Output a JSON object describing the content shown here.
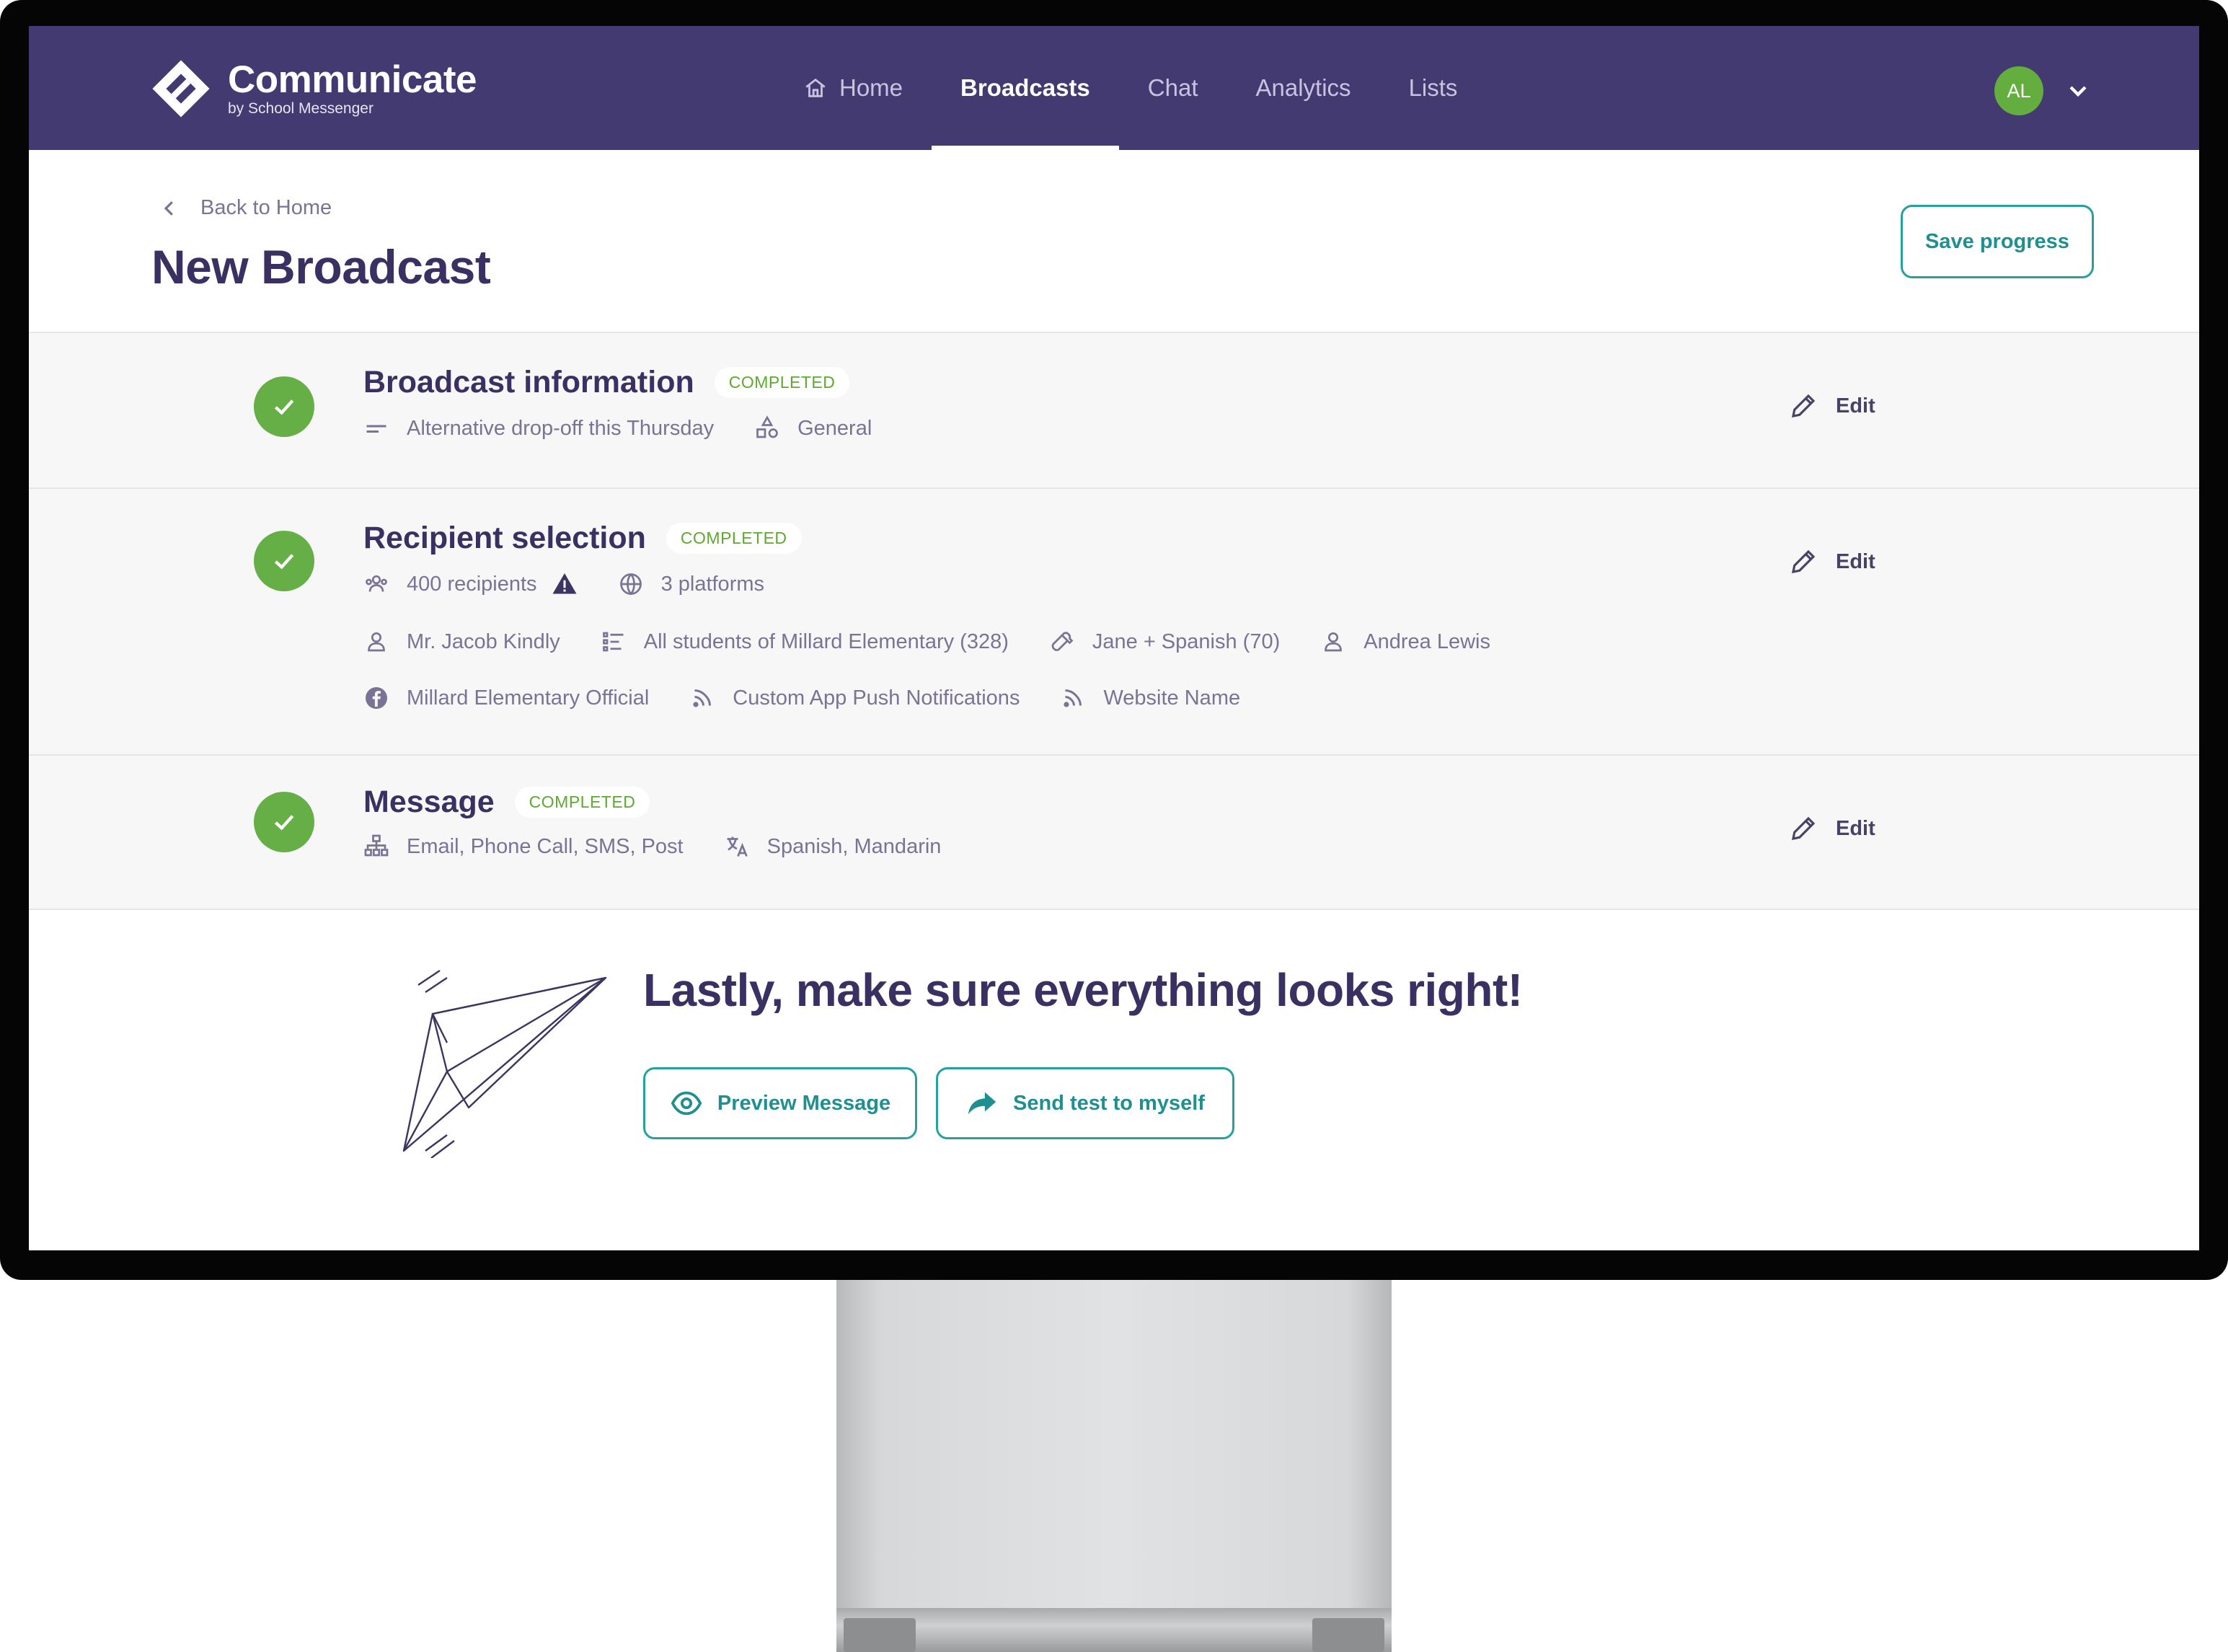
{
  "app": {
    "title": "Communicate",
    "subtitle": "by School Messenger",
    "avatar_initials": "AL"
  },
  "nav": {
    "items": [
      {
        "label": "Home",
        "icon": "home-icon",
        "active": false
      },
      {
        "label": "Broadcasts",
        "active": true
      },
      {
        "label": "Chat",
        "active": false
      },
      {
        "label": "Analytics",
        "active": false
      },
      {
        "label": "Lists",
        "active": false
      }
    ]
  },
  "header": {
    "back_label": "Back to Home",
    "title": "New Broadcast",
    "save_label": "Save progress"
  },
  "steps": [
    {
      "title": "Broadcast information",
      "status": "COMPLETED",
      "edit_label": "Edit",
      "meta": [
        {
          "icon": "subject-lines-icon",
          "text": "Alternative drop-off this Thursday"
        },
        {
          "icon": "category-shapes-icon",
          "text": "General"
        }
      ]
    },
    {
      "title": "Recipient selection",
      "status": "COMPLETED",
      "edit_label": "Edit",
      "summary": [
        {
          "icon": "people-icon",
          "text": "400 recipients",
          "warning": true
        },
        {
          "icon": "globe-icon",
          "text": "3 platforms"
        }
      ],
      "recipients": [
        {
          "icon": "person-icon",
          "text": "Mr. Jacob Kindly"
        },
        {
          "icon": "list-icon",
          "text": "All students of Millard Elementary (328)"
        },
        {
          "icon": "wrench-icon",
          "text": "Jane + Spanish (70)"
        },
        {
          "icon": "person-icon",
          "text": "Andrea Lewis"
        }
      ],
      "platforms": [
        {
          "icon": "facebook-icon",
          "text": "Millard Elementary Official"
        },
        {
          "icon": "rss-icon",
          "text": "Custom App Push Notifications"
        },
        {
          "icon": "rss-icon",
          "text": "Website Name"
        }
      ]
    },
    {
      "title": "Message",
      "status": "COMPLETED",
      "edit_label": "Edit",
      "meta": [
        {
          "icon": "channels-icon",
          "text": "Email, Phone Call, SMS, Post"
        },
        {
          "icon": "translate-icon",
          "text": "Spanish, Mandarin"
        }
      ]
    }
  ],
  "final": {
    "title": "Lastly, make sure everything looks right!",
    "preview_label": "Preview Message",
    "send_test_label": "Send test to myself"
  },
  "colors": {
    "nav_bg": "#443a72",
    "accent_teal": "#27a0a0",
    "success_green": "#66ae46",
    "title_purple": "#3a3162"
  }
}
